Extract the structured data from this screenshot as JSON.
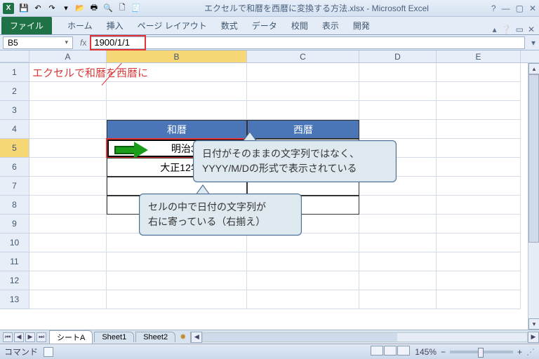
{
  "titlebar": {
    "icon_label": "X",
    "title": "エクセルで和暦を西暦に変換する方法.xlsx - Microsoft Excel",
    "qat_icons": [
      "save-icon",
      "undo-icon",
      "redo-icon",
      "open-icon",
      "quickprint-icon",
      "print-preview-icon",
      "new-icon",
      "chart-icon"
    ]
  },
  "ribbon": {
    "file_label": "ファイル",
    "tabs": [
      "ホーム",
      "挿入",
      "ページ レイアウト",
      "数式",
      "データ",
      "校閲",
      "表示",
      "開発"
    ]
  },
  "formula_bar": {
    "name_box": "B5",
    "formula": "1900/1/1"
  },
  "columns": [
    "A",
    "B",
    "C",
    "D",
    "E"
  ],
  "rows": [
    "1",
    "2",
    "3",
    "4",
    "5",
    "6",
    "7",
    "8",
    "9",
    "10",
    "11",
    "12",
    "13"
  ],
  "cells": {
    "A1": "エクセルで和暦を西暦に",
    "B4": "和暦",
    "C4": "西暦",
    "B5": "明治33年1月1日",
    "B6": "大正12年10月23日"
  },
  "callouts": {
    "c1_line1": "日付がそのままの文字列ではなく、",
    "c1_line2": "YYYY/M/Dの形式で表示されている",
    "c2_line1": "セルの中で日付の文字列が",
    "c2_line2": "右に寄っている（右揃え）"
  },
  "sheets": {
    "tabs": [
      "シートA",
      "Sheet1",
      "Sheet2"
    ]
  },
  "status": {
    "mode": "コマンド",
    "zoom": "145%"
  }
}
